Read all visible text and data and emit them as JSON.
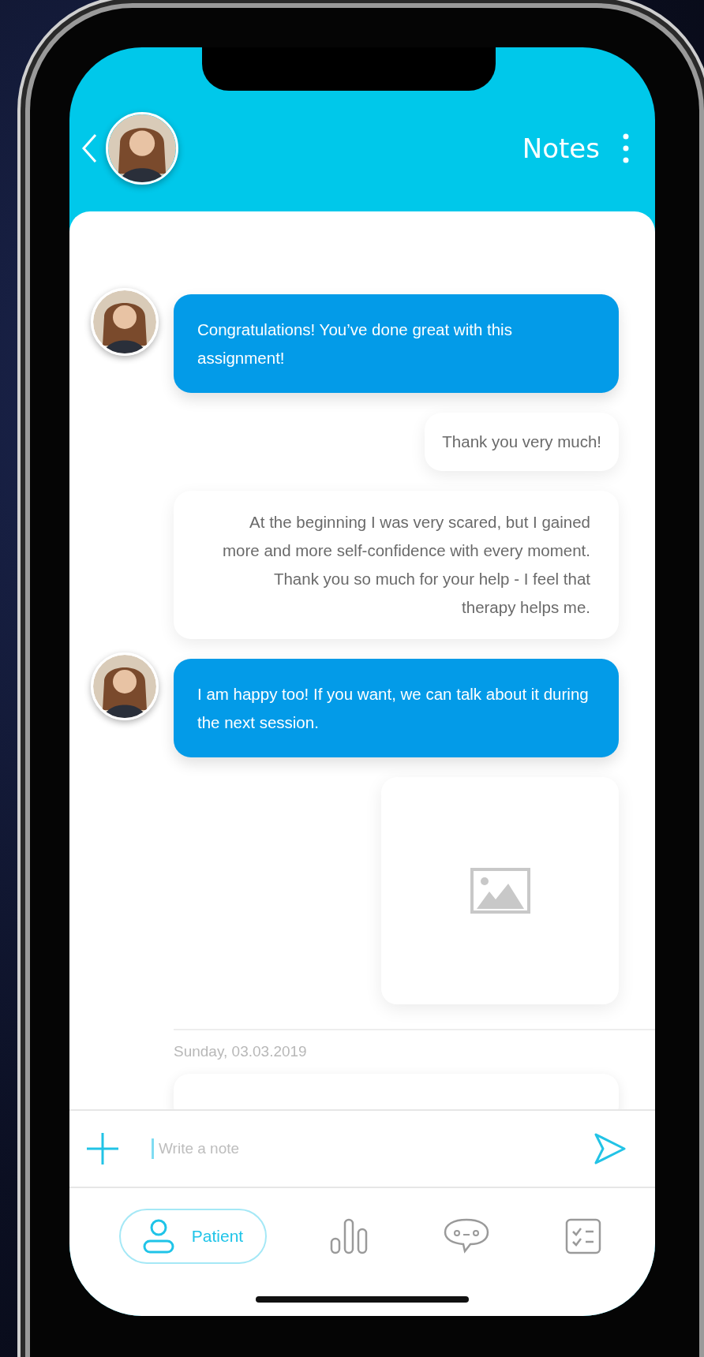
{
  "header": {
    "title": "Notes"
  },
  "messages": [
    {
      "kind": "incoming",
      "text": "Congratulations! You’ve done great with this assignment!"
    },
    {
      "kind": "outgoing",
      "text": "Thank you very much!"
    },
    {
      "kind": "outgoing",
      "text": "At the beginning I was very scared, but I gained more and more self-confidence with every moment. Thank you so much for your help - I feel that therapy helps me."
    },
    {
      "kind": "incoming",
      "text": "I am happy too! If you want, we can talk about it during the next session."
    },
    {
      "kind": "image"
    },
    {
      "kind": "date",
      "text": "Sunday, 03.03.2019"
    },
    {
      "kind": "cut_off"
    }
  ],
  "composer": {
    "placeholder": "Write a note"
  },
  "nav": [
    {
      "kind": "patient",
      "label": "Patient",
      "selected": true
    },
    {
      "kind": "stats",
      "selected": false
    },
    {
      "kind": "chat",
      "selected": false
    },
    {
      "kind": "tasks",
      "selected": false
    }
  ]
}
